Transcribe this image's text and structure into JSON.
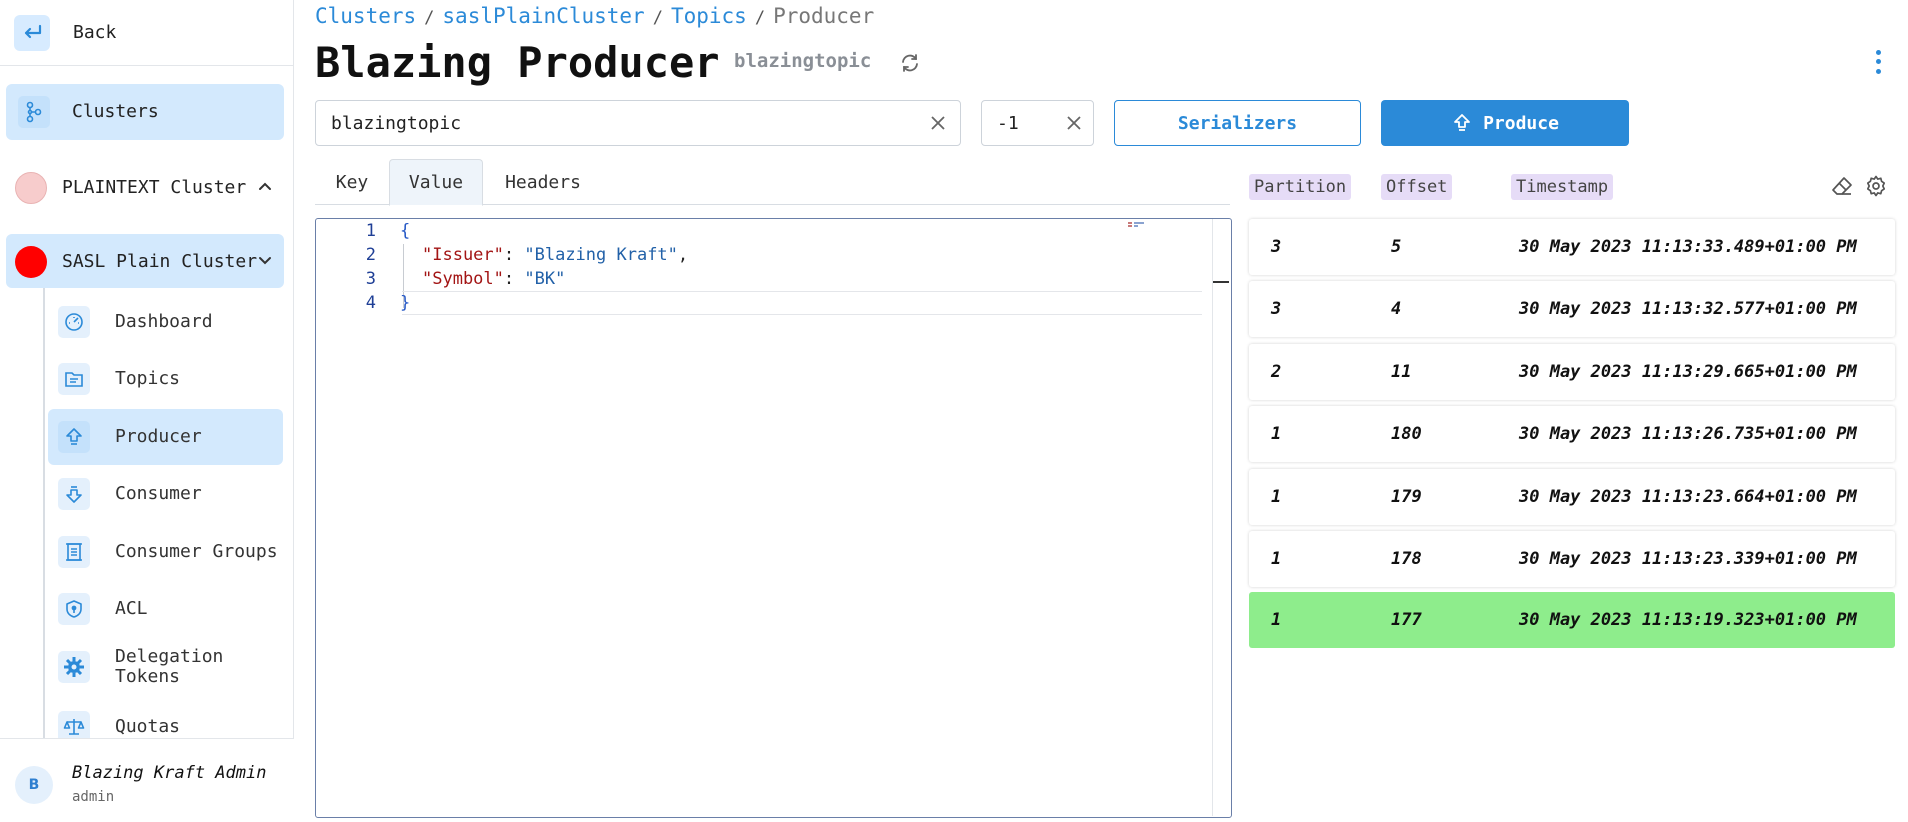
{
  "sidebar": {
    "back_label": "Back",
    "clusters_label": "Clusters",
    "clusters": [
      {
        "label": "PLAINTEXT Cluster",
        "expanded": true,
        "color": "#f7cccc"
      },
      {
        "label": "SASL Plain Cluster",
        "expanded": true,
        "color": "#ff0000"
      }
    ],
    "items": [
      {
        "label": "Dashboard",
        "icon": "gauge-icon"
      },
      {
        "label": "Topics",
        "icon": "topics-icon"
      },
      {
        "label": "Producer",
        "icon": "producer-icon",
        "active": true
      },
      {
        "label": "Consumer",
        "icon": "consumer-icon"
      },
      {
        "label": "Consumer Groups",
        "icon": "consumer-groups-icon"
      },
      {
        "label": "ACL",
        "icon": "shield-icon"
      },
      {
        "label_line1": "Delegation",
        "label_line2": "Tokens",
        "icon": "gear-burst-icon"
      },
      {
        "label": "Quotas",
        "icon": "scale-icon"
      }
    ],
    "user": {
      "initial": "B",
      "name": "Blazing Kraft Admin",
      "role": "admin"
    }
  },
  "breadcrumb": {
    "items": [
      "Clusters",
      "saslPlainCluster",
      "Topics"
    ],
    "separator": "/",
    "current": "Producer"
  },
  "header": {
    "title": "Blazing Producer",
    "subtitle": "blazingtopic"
  },
  "form": {
    "topic_value": "blazingtopic",
    "partition_value": "-1",
    "serializers_label": "Serializers",
    "produce_label": "Produce"
  },
  "tabs": [
    {
      "label": "Key"
    },
    {
      "label": "Value",
      "active": true
    },
    {
      "label": "Headers"
    }
  ],
  "editor": {
    "line_numbers": [
      "1",
      "2",
      "3",
      "4"
    ],
    "open_brace": "{",
    "close_brace": "}",
    "lines": [
      {
        "key": "\"Issuer\"",
        "colon": ": ",
        "value": "\"Blazing Kraft\"",
        "trail": ","
      },
      {
        "key": "\"Symbol\"",
        "colon": ": ",
        "value": "\"BK\"",
        "trail": ""
      }
    ]
  },
  "results": {
    "headers": {
      "partition": "Partition",
      "offset": "Offset",
      "timestamp": "Timestamp"
    },
    "rows": [
      {
        "partition": "3",
        "offset": "5",
        "timestamp": "30 May 2023 11:13:33.489+01:00 PM"
      },
      {
        "partition": "3",
        "offset": "4",
        "timestamp": "30 May 2023 11:13:32.577+01:00 PM"
      },
      {
        "partition": "2",
        "offset": "11",
        "timestamp": "30 May 2023 11:13:29.665+01:00 PM"
      },
      {
        "partition": "1",
        "offset": "180",
        "timestamp": "30 May 2023 11:13:26.735+01:00 PM"
      },
      {
        "partition": "1",
        "offset": "179",
        "timestamp": "30 May 2023 11:13:23.664+01:00 PM"
      },
      {
        "partition": "1",
        "offset": "178",
        "timestamp": "30 May 2023 11:13:23.339+01:00 PM"
      },
      {
        "partition": "1",
        "offset": "177",
        "timestamp": "30 May 2023 11:13:19.323+01:00 PM",
        "highlighted": true
      }
    ],
    "highlight_color": "#8eed8c"
  },
  "colors": {
    "accent": "#2b8ad8",
    "active_bg": "#d3e9fd",
    "pill_bg": "#e6dcf7"
  }
}
